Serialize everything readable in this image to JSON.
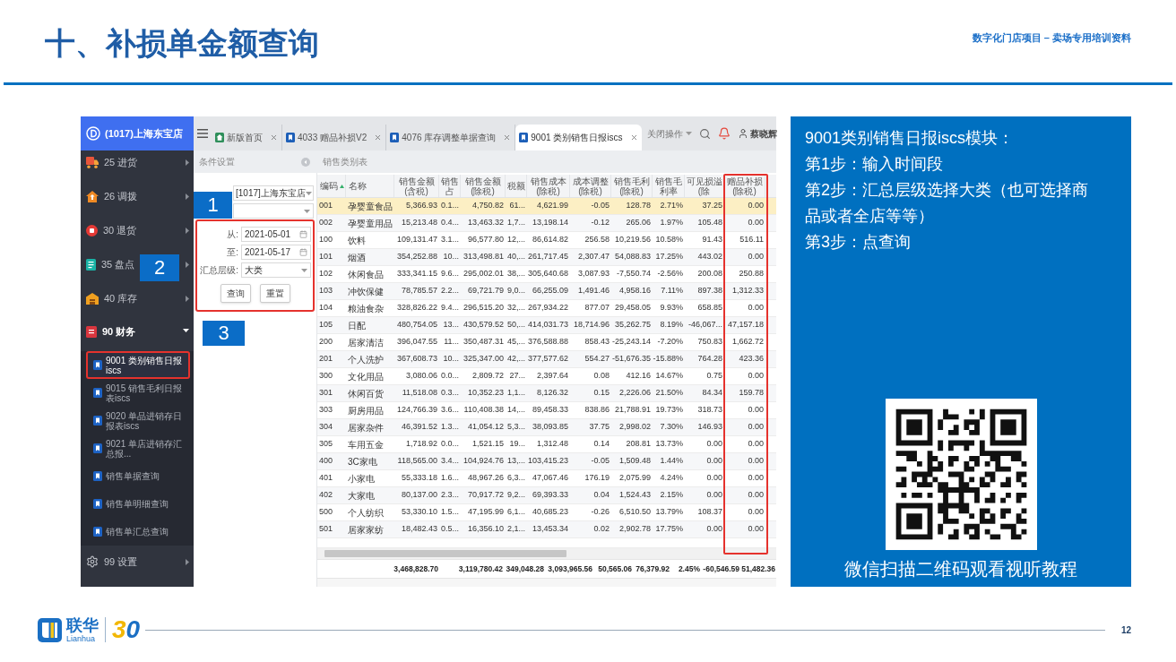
{
  "slide": {
    "title": "十、补损单金额查询",
    "header_note": "数字化门店项目 – 卖场专用培训资料",
    "page_number": "12"
  },
  "app": {
    "store_name": "(1017)上海东宝店",
    "menu": [
      {
        "label": "25 进货",
        "expanded": false
      },
      {
        "label": "26 调拨",
        "expanded": false
      },
      {
        "label": "30 退货",
        "expanded": false
      },
      {
        "label": "35 盘点",
        "expanded": false
      },
      {
        "label": "40 库存",
        "expanded": false
      },
      {
        "label": "90 财务",
        "expanded": true,
        "children": [
          {
            "label": "9001 类别销售日报iscs",
            "selected": true,
            "outlined": true
          },
          {
            "label": "9015 销售毛利日报表iscs",
            "selected": false,
            "outlined": false
          },
          {
            "label": "9020 单品进销存日报表iscs",
            "selected": false,
            "outlined": false
          },
          {
            "label": "9021 单店进销存汇总报...",
            "selected": false,
            "outlined": false
          },
          {
            "label": "销售单据查询",
            "selected": false,
            "outlined": false
          },
          {
            "label": "销售单明细查询",
            "selected": false,
            "outlined": false
          },
          {
            "label": "销售单汇总查询",
            "selected": false,
            "outlined": false
          }
        ]
      },
      {
        "label": "99 设置",
        "expanded": false
      }
    ],
    "tabs": [
      {
        "label": "新版首页",
        "kind": "home",
        "selected": false
      },
      {
        "label": "4033 赠品补损V2",
        "kind": "report",
        "selected": false
      },
      {
        "label": "4076 库存调整单据查询",
        "kind": "report",
        "selected": false
      },
      {
        "label": "9001 类别销售日报iscs",
        "kind": "report",
        "selected": true
      }
    ],
    "toolbar": {
      "close_menu": "关闭操作",
      "user": "蔡晓辉"
    },
    "filter_panel": {
      "title": "条件设置",
      "store_select": {
        "value": "[1017]上海东宝店"
      },
      "group": {
        "outlined": true,
        "fields": [
          {
            "label": "从:",
            "value": "2021-05-01",
            "kind": "date"
          },
          {
            "label": "至:",
            "value": "2021-05-17",
            "kind": "date"
          },
          {
            "label": "汇总层级:",
            "value": "大类",
            "kind": "select"
          }
        ],
        "buttons": [
          "查询",
          "重置"
        ]
      }
    },
    "table": {
      "title": "销售类别表",
      "columns": [
        {
          "label": "编码",
          "sorted": true,
          "outlined": false
        },
        {
          "label": "名称",
          "sorted": false,
          "outlined": false
        },
        {
          "label": "销售金额(含税)",
          "sorted": false,
          "outlined": false
        },
        {
          "label": "销售占",
          "sorted": false,
          "outlined": false
        },
        {
          "label": "销售金额(除税)",
          "sorted": false,
          "outlined": false
        },
        {
          "label": "税额",
          "sorted": false,
          "outlined": false
        },
        {
          "label": "销售成本(除税)",
          "sorted": false,
          "outlined": false
        },
        {
          "label": "成本调整(除税)",
          "sorted": false,
          "outlined": false
        },
        {
          "label": "销售毛利(除税)",
          "sorted": false,
          "outlined": false
        },
        {
          "label": "销售毛利率",
          "sorted": false,
          "outlined": false
        },
        {
          "label": "可见损溢(除",
          "sorted": false,
          "outlined": false
        },
        {
          "label": "赠品补损(除税)",
          "sorted": false,
          "outlined": true
        }
      ],
      "rows": [
        {
          "selected": true,
          "cells": [
            "001",
            "孕婴童食品",
            "5,366.93",
            "0.1...",
            "4,750.82",
            "61...",
            "4,621.99",
            "-0.05",
            "128.78",
            "2.71%",
            "37.25",
            "0.00"
          ]
        },
        {
          "selected": false,
          "cells": [
            "002",
            "孕婴童用品",
            "15,213.48",
            "0.4...",
            "13,463.32",
            "1,7...",
            "13,198.14",
            "-0.12",
            "265.06",
            "1.97%",
            "105.48",
            "0.00"
          ]
        },
        {
          "selected": false,
          "cells": [
            "100",
            "饮料",
            "109,131.47",
            "3.1...",
            "96,577.80",
            "12,...",
            "86,614.82",
            "256.58",
            "10,219.56",
            "10.58%",
            "91.43",
            "516.11"
          ]
        },
        {
          "selected": false,
          "cells": [
            "101",
            "烟酒",
            "354,252.88",
            "10...",
            "313,498.81",
            "40,...",
            "261,717.45",
            "2,307.47",
            "54,088.83",
            "17.25%",
            "443.02",
            "0.00"
          ]
        },
        {
          "selected": false,
          "cells": [
            "102",
            "休闲食品",
            "333,341.15",
            "9.6...",
            "295,002.01",
            "38,...",
            "305,640.68",
            "3,087.93",
            "-7,550.74",
            "-2.56%",
            "200.08",
            "250.88"
          ]
        },
        {
          "selected": false,
          "cells": [
            "103",
            "冲饮保健",
            "78,785.57",
            "2.2...",
            "69,721.79",
            "9,0...",
            "66,255.09",
            "1,491.46",
            "4,958.16",
            "7.11%",
            "897.38",
            "1,312.33"
          ]
        },
        {
          "selected": false,
          "cells": [
            "104",
            "粮油食杂",
            "328,826.22",
            "9.4...",
            "296,515.20",
            "32,...",
            "267,934.22",
            "877.07",
            "29,458.05",
            "9.93%",
            "658.85",
            "0.00"
          ]
        },
        {
          "selected": false,
          "cells": [
            "105",
            "日配",
            "480,754.05",
            "13...",
            "430,579.52",
            "50,...",
            "414,031.73",
            "18,714.96",
            "35,262.75",
            "8.19%",
            "-46,067...",
            "47,157.18"
          ]
        },
        {
          "selected": false,
          "cells": [
            "200",
            "居家清洁",
            "396,047.55",
            "11...",
            "350,487.31",
            "45,...",
            "376,588.88",
            "858.43",
            "-25,243.14",
            "-7.20%",
            "750.83",
            "1,662.72"
          ]
        },
        {
          "selected": false,
          "cells": [
            "201",
            "个人洗护",
            "367,608.73",
            "10...",
            "325,347.00",
            "42,...",
            "377,577.62",
            "554.27",
            "-51,676.35",
            "-15.88%",
            "764.28",
            "423.36"
          ]
        },
        {
          "selected": false,
          "cells": [
            "300",
            "文化用品",
            "3,080.06",
            "0.0...",
            "2,809.72",
            "27...",
            "2,397.64",
            "0.08",
            "412.16",
            "14.67%",
            "0.75",
            "0.00"
          ]
        },
        {
          "selected": false,
          "cells": [
            "301",
            "休闲百货",
            "11,518.08",
            "0.3...",
            "10,352.23",
            "1,1...",
            "8,126.32",
            "0.15",
            "2,226.06",
            "21.50%",
            "84.34",
            "159.78"
          ]
        },
        {
          "selected": false,
          "cells": [
            "303",
            "厨房用品",
            "124,766.39",
            "3.6...",
            "110,408.38",
            "14,...",
            "89,458.33",
            "838.86",
            "21,788.91",
            "19.73%",
            "318.73",
            "0.00"
          ]
        },
        {
          "selected": false,
          "cells": [
            "304",
            "居家杂件",
            "46,391.52",
            "1.3...",
            "41,054.12",
            "5,3...",
            "38,093.85",
            "37.75",
            "2,998.02",
            "7.30%",
            "146.93",
            "0.00"
          ]
        },
        {
          "selected": false,
          "cells": [
            "305",
            "车用五金",
            "1,718.92",
            "0.0...",
            "1,521.15",
            "19...",
            "1,312.48",
            "0.14",
            "208.81",
            "13.73%",
            "0.00",
            "0.00"
          ]
        },
        {
          "selected": false,
          "cells": [
            "400",
            "3C家电",
            "118,565.00",
            "3.4...",
            "104,924.76",
            "13,...",
            "103,415.23",
            "-0.05",
            "1,509.48",
            "1.44%",
            "0.00",
            "0.00"
          ]
        },
        {
          "selected": false,
          "cells": [
            "401",
            "小家电",
            "55,333.18",
            "1.6...",
            "48,967.26",
            "6,3...",
            "47,067.46",
            "176.19",
            "2,075.99",
            "4.24%",
            "0.00",
            "0.00"
          ]
        },
        {
          "selected": false,
          "cells": [
            "402",
            "大家电",
            "80,137.00",
            "2.3...",
            "70,917.72",
            "9,2...",
            "69,393.33",
            "0.04",
            "1,524.43",
            "2.15%",
            "0.00",
            "0.00"
          ]
        },
        {
          "selected": false,
          "cells": [
            "500",
            "个人纺织",
            "53,330.10",
            "1.5...",
            "47,195.99",
            "6,1...",
            "40,685.23",
            "-0.26",
            "6,510.50",
            "13.79%",
            "108.37",
            "0.00"
          ]
        },
        {
          "selected": false,
          "cells": [
            "501",
            "居家家纺",
            "18,482.43",
            "0.5...",
            "16,356.10",
            "2,1...",
            "13,453.34",
            "0.02",
            "2,902.78",
            "17.75%",
            "0.00",
            "0.00"
          ]
        }
      ],
      "totals": [
        "3,468,828.70",
        "3,119,780.42",
        "349,048.28",
        "3,093,965.56",
        "50,565.06",
        "76,379.92",
        "2.45%",
        "-60,546.59",
        "51,482.36"
      ]
    }
  },
  "annotations": [
    {
      "label": "1"
    },
    {
      "label": "2"
    },
    {
      "label": "3"
    }
  ],
  "instructions": {
    "heading": "9001类别销售日报iscs模块：",
    "steps": [
      "第1步：输入时间段",
      "第2步：汇总层级选择大类（也可选择商品或者全店等等）",
      "第3步：点查询"
    ],
    "qr_caption": "微信扫描二维码观看视听教程"
  },
  "footer": {
    "brand_cn": "联华",
    "brand_en": "Lianhua",
    "anniversary": "30"
  }
}
